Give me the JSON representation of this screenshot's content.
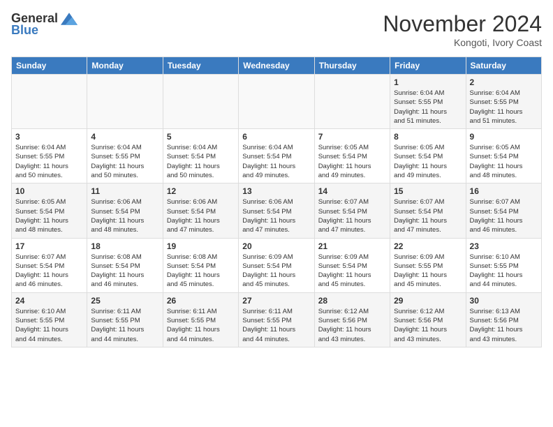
{
  "header": {
    "logo_general": "General",
    "logo_blue": "Blue",
    "month_title": "November 2024",
    "location": "Kongoti, Ivory Coast"
  },
  "calendar": {
    "days_of_week": [
      "Sunday",
      "Monday",
      "Tuesday",
      "Wednesday",
      "Thursday",
      "Friday",
      "Saturday"
    ],
    "weeks": [
      [
        {
          "day": "",
          "info": ""
        },
        {
          "day": "",
          "info": ""
        },
        {
          "day": "",
          "info": ""
        },
        {
          "day": "",
          "info": ""
        },
        {
          "day": "",
          "info": ""
        },
        {
          "day": "1",
          "info": "Sunrise: 6:04 AM\nSunset: 5:55 PM\nDaylight: 11 hours\nand 51 minutes."
        },
        {
          "day": "2",
          "info": "Sunrise: 6:04 AM\nSunset: 5:55 PM\nDaylight: 11 hours\nand 51 minutes."
        }
      ],
      [
        {
          "day": "3",
          "info": "Sunrise: 6:04 AM\nSunset: 5:55 PM\nDaylight: 11 hours\nand 50 minutes."
        },
        {
          "day": "4",
          "info": "Sunrise: 6:04 AM\nSunset: 5:55 PM\nDaylight: 11 hours\nand 50 minutes."
        },
        {
          "day": "5",
          "info": "Sunrise: 6:04 AM\nSunset: 5:54 PM\nDaylight: 11 hours\nand 50 minutes."
        },
        {
          "day": "6",
          "info": "Sunrise: 6:04 AM\nSunset: 5:54 PM\nDaylight: 11 hours\nand 49 minutes."
        },
        {
          "day": "7",
          "info": "Sunrise: 6:05 AM\nSunset: 5:54 PM\nDaylight: 11 hours\nand 49 minutes."
        },
        {
          "day": "8",
          "info": "Sunrise: 6:05 AM\nSunset: 5:54 PM\nDaylight: 11 hours\nand 49 minutes."
        },
        {
          "day": "9",
          "info": "Sunrise: 6:05 AM\nSunset: 5:54 PM\nDaylight: 11 hours\nand 48 minutes."
        }
      ],
      [
        {
          "day": "10",
          "info": "Sunrise: 6:05 AM\nSunset: 5:54 PM\nDaylight: 11 hours\nand 48 minutes."
        },
        {
          "day": "11",
          "info": "Sunrise: 6:06 AM\nSunset: 5:54 PM\nDaylight: 11 hours\nand 48 minutes."
        },
        {
          "day": "12",
          "info": "Sunrise: 6:06 AM\nSunset: 5:54 PM\nDaylight: 11 hours\nand 47 minutes."
        },
        {
          "day": "13",
          "info": "Sunrise: 6:06 AM\nSunset: 5:54 PM\nDaylight: 11 hours\nand 47 minutes."
        },
        {
          "day": "14",
          "info": "Sunrise: 6:07 AM\nSunset: 5:54 PM\nDaylight: 11 hours\nand 47 minutes."
        },
        {
          "day": "15",
          "info": "Sunrise: 6:07 AM\nSunset: 5:54 PM\nDaylight: 11 hours\nand 47 minutes."
        },
        {
          "day": "16",
          "info": "Sunrise: 6:07 AM\nSunset: 5:54 PM\nDaylight: 11 hours\nand 46 minutes."
        }
      ],
      [
        {
          "day": "17",
          "info": "Sunrise: 6:07 AM\nSunset: 5:54 PM\nDaylight: 11 hours\nand 46 minutes."
        },
        {
          "day": "18",
          "info": "Sunrise: 6:08 AM\nSunset: 5:54 PM\nDaylight: 11 hours\nand 46 minutes."
        },
        {
          "day": "19",
          "info": "Sunrise: 6:08 AM\nSunset: 5:54 PM\nDaylight: 11 hours\nand 45 minutes."
        },
        {
          "day": "20",
          "info": "Sunrise: 6:09 AM\nSunset: 5:54 PM\nDaylight: 11 hours\nand 45 minutes."
        },
        {
          "day": "21",
          "info": "Sunrise: 6:09 AM\nSunset: 5:54 PM\nDaylight: 11 hours\nand 45 minutes."
        },
        {
          "day": "22",
          "info": "Sunrise: 6:09 AM\nSunset: 5:55 PM\nDaylight: 11 hours\nand 45 minutes."
        },
        {
          "day": "23",
          "info": "Sunrise: 6:10 AM\nSunset: 5:55 PM\nDaylight: 11 hours\nand 44 minutes."
        }
      ],
      [
        {
          "day": "24",
          "info": "Sunrise: 6:10 AM\nSunset: 5:55 PM\nDaylight: 11 hours\nand 44 minutes."
        },
        {
          "day": "25",
          "info": "Sunrise: 6:11 AM\nSunset: 5:55 PM\nDaylight: 11 hours\nand 44 minutes."
        },
        {
          "day": "26",
          "info": "Sunrise: 6:11 AM\nSunset: 5:55 PM\nDaylight: 11 hours\nand 44 minutes."
        },
        {
          "day": "27",
          "info": "Sunrise: 6:11 AM\nSunset: 5:55 PM\nDaylight: 11 hours\nand 44 minutes."
        },
        {
          "day": "28",
          "info": "Sunrise: 6:12 AM\nSunset: 5:56 PM\nDaylight: 11 hours\nand 43 minutes."
        },
        {
          "day": "29",
          "info": "Sunrise: 6:12 AM\nSunset: 5:56 PM\nDaylight: 11 hours\nand 43 minutes."
        },
        {
          "day": "30",
          "info": "Sunrise: 6:13 AM\nSunset: 5:56 PM\nDaylight: 11 hours\nand 43 minutes."
        }
      ]
    ]
  }
}
